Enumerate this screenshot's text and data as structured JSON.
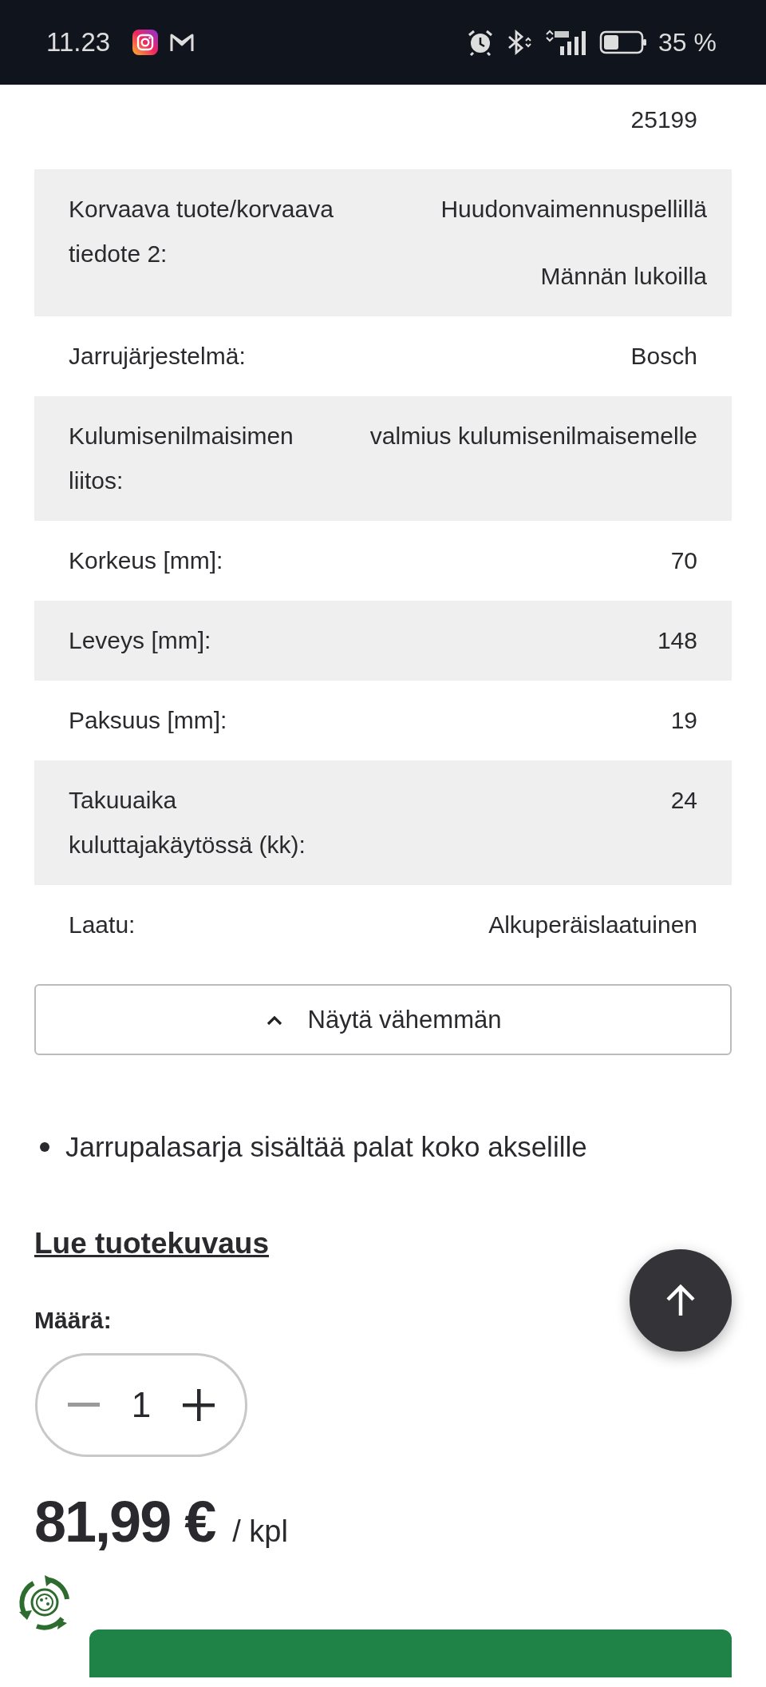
{
  "status_bar": {
    "time": "11.23",
    "battery": "35 %"
  },
  "specs": [
    {
      "values": [
        "25199"
      ]
    },
    {
      "label": "Korvaava tuote/korvaava tiedote 2:",
      "values": [
        "Huudonvaimennuspellillä",
        "Männän lukoilla"
      ]
    },
    {
      "label": "Jarrujärjestelmä:",
      "values": [
        "Bosch"
      ]
    },
    {
      "label": "Kulumisenilmaisimen liitos:",
      "values": [
        "valmius kulumisenilmaisemelle"
      ]
    },
    {
      "label": "Korkeus [mm]:",
      "values": [
        "70"
      ]
    },
    {
      "label": "Leveys [mm]:",
      "values": [
        "148"
      ]
    },
    {
      "label": "Paksuus [mm]:",
      "values": [
        "19"
      ]
    },
    {
      "label": "Takuuaika kuluttajakäytössä (kk):",
      "values": [
        "24"
      ]
    },
    {
      "label": "Laatu:",
      "values": [
        "Alkuperäislaatuinen"
      ]
    }
  ],
  "toggle_button": "Näytä vähemmän",
  "bullets": [
    "Jarrupalasarja sisältää palat koko akselille"
  ],
  "description_link": "Lue tuotekuvaus",
  "quantity": {
    "label": "Määrä:",
    "value": "1",
    "decrement_disabled": true
  },
  "price": {
    "amount": "81,99 €",
    "unit": "/ kpl"
  }
}
